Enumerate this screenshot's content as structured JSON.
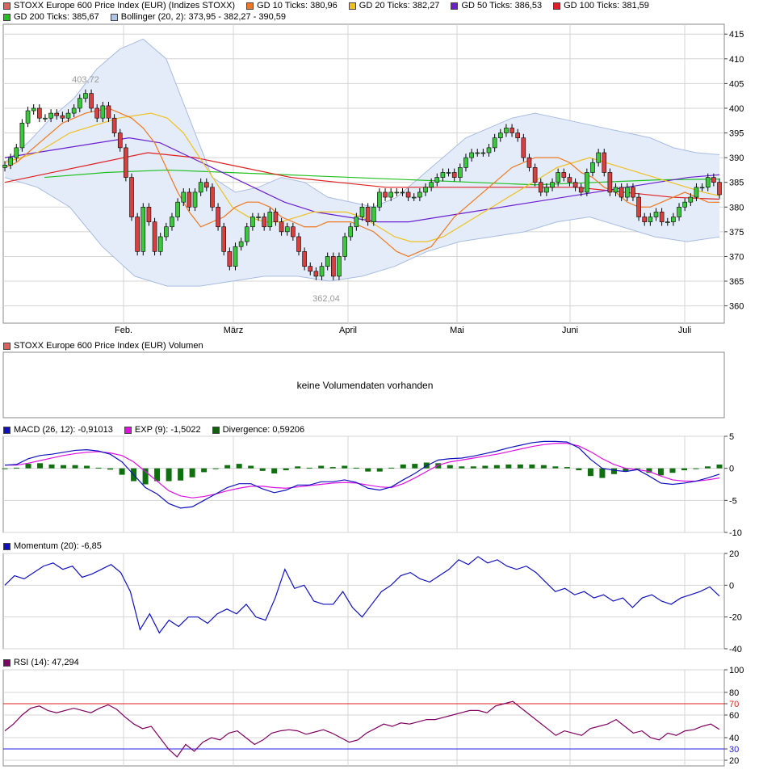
{
  "legends": {
    "main": [
      {
        "label": "STOXX Europe 600 Price Index (EUR) (Indizes STOXX)",
        "color": "#e06060"
      },
      {
        "label": "GD 10 Ticks: 380,96",
        "color": "#f07820"
      },
      {
        "label": "GD 20 Ticks: 382,27",
        "color": "#f0c020"
      },
      {
        "label": "GD 50 Ticks: 386,53",
        "color": "#6a1fd0"
      },
      {
        "label": "GD 100 Ticks: 381,59",
        "color": "#e02020"
      },
      {
        "label": "GD 200 Ticks: 385,67",
        "color": "#20c020"
      },
      {
        "label": "Bollinger (20, 2): 373,95 - 382,27 - 390,59",
        "color": "#b0c4e8"
      }
    ],
    "volume": [
      {
        "label": "STOXX Europe 600 Price Index (EUR) Volumen",
        "color": "#e06060"
      }
    ],
    "macd": [
      {
        "label": "MACD (26, 12): -0,91013",
        "color": "#1010c0"
      },
      {
        "label": "EXP (9): -1,5022",
        "color": "#e010e0"
      },
      {
        "label": "Divergence: 0,59206",
        "color": "#106010"
      }
    ],
    "momentum": [
      {
        "label": "Momentum (20): -6,85",
        "color": "#1010c0"
      }
    ],
    "rsi": [
      {
        "label": "RSI (14): 47,294",
        "color": "#800060"
      }
    ]
  },
  "volume_message": "keine Volumendaten vorhanden",
  "colors": {
    "up": "#3cc83c",
    "down": "#d84040",
    "grid": "#d4d4d4",
    "band": "#e4ecfa"
  },
  "chart_data": [
    {
      "type": "candlestick",
      "title": "STOXX Europe 600 Price Index (EUR) (Indizes STOXX)",
      "x_tick_labels": [
        "Feb.",
        "März",
        "April",
        "Mai",
        "Juni",
        "Juli"
      ],
      "y_ticks": [
        360,
        365,
        370,
        375,
        380,
        385,
        390,
        395,
        400,
        405,
        410,
        415
      ],
      "ylim": [
        356.5,
        417
      ],
      "annotations": [
        "403,72",
        "362,04"
      ],
      "close": [
        388.5,
        390,
        392,
        397,
        399.5,
        400,
        398,
        398,
        399,
        398.5,
        398,
        399,
        400,
        402,
        403,
        400,
        398,
        400.5,
        398,
        395,
        392,
        386,
        378,
        371,
        380,
        377,
        371,
        374,
        376,
        378,
        381,
        383,
        380,
        383,
        385,
        384,
        380,
        376,
        371,
        368,
        372,
        373,
        376,
        378,
        378,
        376,
        379,
        377,
        375,
        376,
        374,
        371,
        368,
        367,
        366,
        368,
        370,
        366,
        370,
        374,
        376,
        378,
        380,
        377,
        380,
        383,
        382,
        383,
        383,
        383,
        382,
        382,
        383,
        384,
        385,
        386,
        387,
        387,
        386,
        388,
        390,
        391,
        391,
        391,
        392,
        394,
        395,
        396,
        395,
        394,
        390,
        388,
        385,
        383,
        384,
        385,
        387,
        386,
        385,
        384,
        383,
        387,
        389,
        391,
        387,
        383,
        384,
        382,
        384,
        382,
        378,
        377,
        378,
        379,
        377,
        377,
        378,
        380,
        381,
        382,
        384,
        384,
        386,
        385,
        382.5
      ],
      "open": [
        388,
        388.5,
        390,
        392,
        397,
        399.5,
        400,
        398,
        398,
        399,
        398.5,
        398,
        399,
        400,
        402,
        403,
        400,
        398,
        400.5,
        398,
        395,
        392,
        386,
        378,
        371,
        380,
        377,
        371,
        374,
        376,
        378,
        381,
        383,
        380,
        383,
        385,
        384,
        380,
        376,
        371,
        368,
        372,
        373,
        376,
        378,
        378,
        376,
        379,
        377,
        375,
        376,
        374,
        371,
        368,
        367,
        366,
        368,
        370,
        366,
        370,
        374,
        376,
        378,
        380,
        377,
        380,
        383,
        382,
        383,
        383,
        383,
        382,
        382,
        383,
        384,
        385,
        386,
        387,
        387,
        386,
        388,
        390,
        391,
        391,
        391,
        392,
        394,
        395,
        396,
        395,
        394,
        390,
        388,
        385,
        383,
        384,
        385,
        387,
        386,
        385,
        384,
        383,
        387,
        389,
        391,
        387,
        383,
        384,
        382,
        384,
        382,
        378,
        377,
        378,
        379,
        377,
        377,
        378,
        380,
        381,
        382,
        384,
        384,
        386,
        385
      ],
      "gd10": [
        388,
        389,
        391,
        393,
        395,
        397,
        398,
        399,
        399.5,
        400,
        399,
        398,
        396,
        393,
        388,
        383,
        379,
        376,
        377,
        378,
        380,
        381,
        381,
        380,
        378,
        377,
        376,
        376,
        377,
        377,
        377,
        376,
        375,
        373,
        371,
        370,
        371,
        372,
        375,
        378,
        380,
        382,
        384,
        386,
        388,
        389,
        390,
        390,
        390,
        389,
        387,
        386,
        384,
        383,
        381,
        380,
        380,
        381,
        382,
        383,
        382,
        381,
        380.96
      ],
      "gd20": [
        389,
        390,
        391,
        393,
        395,
        396,
        397,
        398,
        398.5,
        399,
        398,
        395,
        390,
        385,
        380,
        378,
        377,
        377,
        378,
        379,
        379,
        379,
        378,
        376,
        374,
        373,
        373,
        374,
        376,
        378,
        380,
        382,
        384,
        386,
        388,
        389,
        390,
        389,
        388,
        387,
        386,
        385,
        384,
        383,
        382.27
      ],
      "gd50": [
        390,
        391,
        392,
        393,
        394,
        393,
        390,
        387,
        384,
        381,
        379,
        378,
        377,
        377,
        378,
        379,
        380,
        381,
        382,
        383,
        384,
        385,
        386,
        386.53
      ],
      "gd100": [
        385,
        387,
        389,
        391,
        390,
        388,
        386,
        385,
        384,
        384,
        384,
        384,
        384,
        383,
        382,
        381.59
      ],
      "gd200": [
        386,
        387,
        387.5,
        387,
        386.5,
        386,
        385.5,
        385,
        384.5,
        385,
        385.5,
        385.67
      ],
      "bollinger_upper": [
        389,
        393,
        398,
        402,
        408,
        412,
        414,
        410,
        398,
        386,
        383,
        384,
        386,
        385,
        382,
        381,
        380,
        382,
        386,
        390,
        394,
        396,
        398,
        399,
        398,
        397,
        396,
        395,
        394,
        392,
        391,
        390.59
      ],
      "bollinger_lower": [
        386,
        384,
        380,
        372,
        366,
        364,
        364,
        365,
        366,
        366,
        365,
        366,
        368,
        371,
        373,
        374,
        375,
        377,
        378,
        376,
        374,
        373,
        373.95
      ]
    },
    {
      "type": "line",
      "title": "MACD (26, 12)",
      "y_ticks": [
        5,
        0,
        -5,
        -10
      ],
      "ylim": [
        -10,
        5
      ],
      "series": [
        {
          "name": "MACD (26, 12)",
          "values": [
            0.5,
            0.6,
            1.5,
            2,
            2.2,
            2.5,
            2.8,
            2.9,
            2.7,
            2.2,
            1,
            -1,
            -3,
            -4,
            -5.5,
            -6.2,
            -6,
            -5,
            -4,
            -3,
            -2.4,
            -2.4,
            -3.2,
            -3.8,
            -3.4,
            -2.6,
            -2.6,
            -2.1,
            -2.1,
            -1.8,
            -2.2,
            -3.1,
            -3.4,
            -2.9,
            -1.8,
            -0.8,
            0.4,
            1.3,
            1.5,
            1.6,
            1.9,
            2.3,
            2.7,
            3.2,
            3.6,
            4,
            4.2,
            4.2,
            4.1,
            3.2,
            1.4,
            0,
            -0.3,
            -0.5,
            -0.2,
            -1.2,
            -2.3,
            -2.5,
            -2.3,
            -2,
            -1.5,
            -0.91
          ]
        },
        {
          "name": "EXP (9)",
          "values": [
            0.5,
            0.5,
            0.8,
            1.2,
            1.6,
            2,
            2.3,
            2.5,
            2.6,
            2.4,
            2,
            1,
            -0.5,
            -2,
            -3.5,
            -4.3,
            -4.6,
            -4.4,
            -4,
            -3.5,
            -3.1,
            -2.8,
            -2.8,
            -3,
            -3.1,
            -2.9,
            -2.7,
            -2.5,
            -2.3,
            -2.2,
            -2.3,
            -2.6,
            -2.9,
            -3,
            -2.4,
            -1.5,
            -0.5,
            0.5,
            1,
            1.3,
            1.6,
            1.9,
            2.2,
            2.6,
            3,
            3.4,
            3.7,
            3.9,
            3.9,
            3.5,
            2.6,
            1.5,
            0.6,
            0,
            -0.2,
            -0.5,
            -1.2,
            -1.8,
            -2,
            -2,
            -1.8,
            -1.5
          ]
        },
        {
          "name": "Divergence",
          "values": [
            0,
            0.1,
            0.7,
            0.8,
            0.6,
            0.5,
            0.5,
            0.4,
            0.1,
            -0.2,
            -1,
            -2,
            -2.5,
            -2,
            -2,
            -1.9,
            -1.4,
            -0.6,
            0,
            0.5,
            0.7,
            0.4,
            -0.4,
            -0.8,
            -0.3,
            0.3,
            0.1,
            0.4,
            0.2,
            0.4,
            0.1,
            -0.5,
            -0.5,
            0.1,
            0.6,
            0.7,
            0.9,
            0.8,
            0.5,
            0.3,
            0.3,
            0.4,
            0.5,
            0.6,
            0.6,
            0.6,
            0.5,
            0.3,
            0.2,
            -0.3,
            -1.2,
            -1.5,
            -0.9,
            -0.5,
            0,
            -0.7,
            -1.1,
            -0.7,
            -0.3,
            0,
            0.3,
            0.59
          ]
        }
      ]
    },
    {
      "type": "line",
      "title": "Momentum (20)",
      "y_ticks": [
        20,
        0,
        -20,
        -40
      ],
      "ylim": [
        -40,
        20
      ],
      "series": [
        {
          "name": "Momentum (20)",
          "values": [
            0,
            6,
            4,
            8,
            12,
            14,
            10,
            12,
            5,
            7,
            10,
            13,
            8,
            -4,
            -28,
            -18,
            -30,
            -22,
            -26,
            -20,
            -20,
            -24,
            -18,
            -15,
            -18,
            -12,
            -20,
            -22,
            -8,
            10,
            -2,
            0,
            -10,
            -12,
            -12,
            -4,
            -14,
            -20,
            -12,
            -4,
            0,
            6,
            8,
            4,
            2,
            6,
            10,
            16,
            13,
            18,
            14,
            16,
            12,
            10,
            12,
            8,
            2,
            -4,
            -2,
            -6,
            -4,
            -8,
            -6,
            -10,
            -8,
            -14,
            -8,
            -6,
            -10,
            -12,
            -8,
            -6,
            -4,
            -1,
            -6.85
          ]
        }
      ]
    },
    {
      "type": "line",
      "title": "RSI (14)",
      "y_ticks": [
        100,
        80,
        70,
        60,
        40,
        30,
        20
      ],
      "reference_lines": [
        70,
        30
      ],
      "ylim": [
        15,
        100
      ],
      "series": [
        {
          "name": "RSI (14)",
          "values": [
            46,
            52,
            60,
            66,
            68,
            64,
            62,
            64,
            66,
            64,
            62,
            66,
            69,
            65,
            58,
            52,
            48,
            50,
            40,
            30,
            23,
            34,
            28,
            36,
            40,
            38,
            44,
            46,
            40,
            34,
            38,
            44,
            46,
            47,
            46,
            43,
            45,
            47,
            44,
            40,
            36,
            38,
            44,
            48,
            52,
            50,
            53,
            52,
            54,
            56,
            56,
            58,
            60,
            62,
            64,
            64,
            62,
            68,
            70,
            72,
            66,
            60,
            54,
            48,
            42,
            46,
            44,
            42,
            48,
            50,
            52,
            56,
            50,
            44,
            46,
            40,
            38,
            44,
            42,
            46,
            47,
            50,
            52,
            47.29
          ]
        }
      ]
    }
  ]
}
